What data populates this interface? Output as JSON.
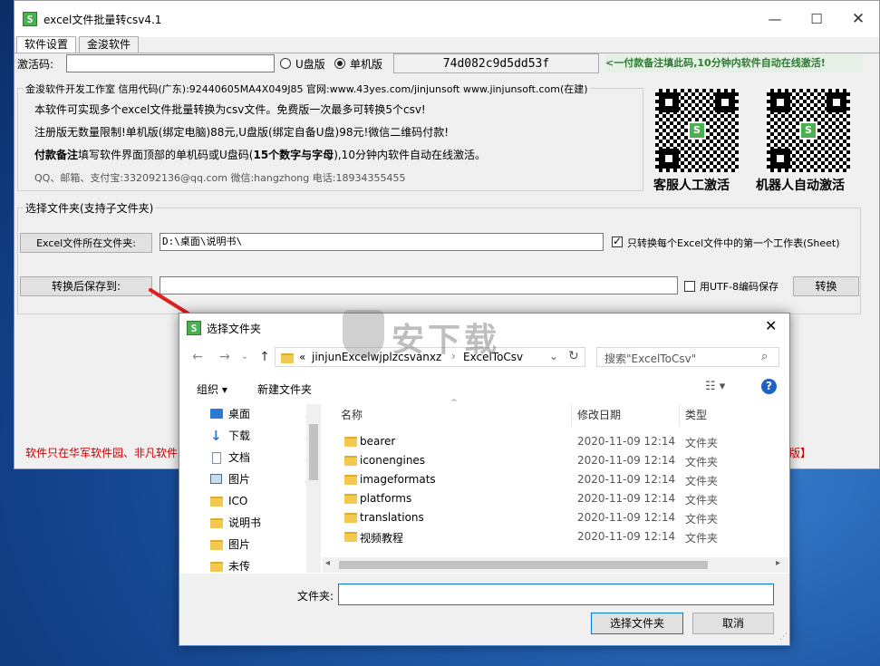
{
  "window": {
    "title": "excel文件批量转csv4.1",
    "app_icon": "S"
  },
  "tabs": [
    "软件设置",
    "金浚软件"
  ],
  "activation": {
    "label": "激活码:",
    "code_value": "",
    "option_usb": "U盘版",
    "option_pc": "单机版",
    "selected": "单机版",
    "machine_code": "74d082c9d5dd53f",
    "hint": "<一付款备注填此码,10分钟内软件自动在线激活!"
  },
  "info": {
    "legend": "金浚软件开发工作室 信用代码(广东):92440605MA4X049J85 官网:www.43yes.com/jinjunsoft  www.jinjunsoft.com(在建)",
    "line1": "本软件可实现多个excel文件批量转换为csv文件。免费版一次最多可转换5个csv!",
    "line2": "注册版无数量限制!单机版(绑定电脑)88元,U盘版(绑定自备U盘)98元!微信二维码付款!",
    "line3_bold": "付款备注",
    "line3": "填写软件界面顶部的单机码或U盘码(",
    "line3_bold2": "15个数字与字母",
    "line3_end": "),10分钟内软件自动在线激活。",
    "contact": "QQ、邮箱、支付宝:332092136@qq.com   微信:hangzhong   电话:18934355455",
    "qr1_label": "客服人工激活",
    "qr2_label": "机器人自动激活"
  },
  "folder_section": {
    "legend": "选择文件夹(支持子文件夹)",
    "excel_folder_button": "Excel文件所在文件夹:",
    "excel_folder_value": "D:\\桌面\\说明书\\",
    "first_sheet_check": "只转换每个Excel文件中的第一个工作表(Sheet)",
    "first_sheet_checked": true,
    "save_button": "转换后保存到:",
    "save_value": "",
    "utf8_check": "用UTF-8编码保存",
    "utf8_checked": false,
    "convert_button": "转换"
  },
  "footer": {
    "left": "软件只在华军软件园、非凡软件",
    "right": "版】"
  },
  "dialog": {
    "title": "选择文件夹",
    "breadcrumb_prefix": "«",
    "breadcrumb": [
      "jinjunExcelwjplzcsvanxz",
      "ExcelToCsv"
    ],
    "search_placeholder": "搜索\"ExcelToCsv\"",
    "organize": "组织 ▾",
    "new_folder": "新建文件夹",
    "columns": [
      "名称",
      "修改日期",
      "类型"
    ],
    "nav": [
      {
        "label": "桌面",
        "icon": "desktop-icon",
        "pinned": true
      },
      {
        "label": "下载",
        "icon": "download-icon",
        "pinned": true
      },
      {
        "label": "文档",
        "icon": "document-icon",
        "pinned": true
      },
      {
        "label": "图片",
        "icon": "picture-icon",
        "pinned": true
      },
      {
        "label": "ICO",
        "icon": "folder-icon",
        "pinned": false
      },
      {
        "label": "说明书",
        "icon": "folder-icon",
        "pinned": false
      },
      {
        "label": "图片",
        "icon": "folder-icon",
        "pinned": false
      },
      {
        "label": "未传",
        "icon": "folder-icon",
        "pinned": false
      }
    ],
    "files": [
      {
        "name": "bearer",
        "date": "2020-11-09 12:14",
        "type": "文件夹"
      },
      {
        "name": "iconengines",
        "date": "2020-11-09 12:14",
        "type": "文件夹"
      },
      {
        "name": "imageformats",
        "date": "2020-11-09 12:14",
        "type": "文件夹"
      },
      {
        "name": "platforms",
        "date": "2020-11-09 12:14",
        "type": "文件夹"
      },
      {
        "name": "translations",
        "date": "2020-11-09 12:14",
        "type": "文件夹"
      },
      {
        "name": "视频教程",
        "date": "2020-11-09 12:14",
        "type": "文件夹"
      }
    ],
    "folder_label": "文件夹:",
    "folder_value": "",
    "select_button": "选择文件夹",
    "cancel_button": "取消"
  },
  "watermark": "安下载",
  "colors": {
    "accent_blue": "#0078d7",
    "hint_green": "#e6f0e6",
    "footer_red": "#cc0000",
    "arrow_red": "#e02020"
  }
}
